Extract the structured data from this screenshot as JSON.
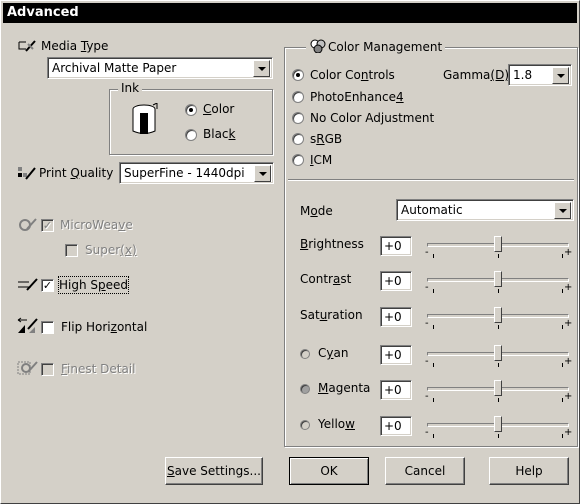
{
  "window": {
    "title": "Advanced"
  },
  "media_type": {
    "label_pre": "Media ",
    "label_u": "T",
    "label_post": "ype",
    "value": "Archival Matte Paper",
    "icon": "media-type-icon"
  },
  "ink": {
    "legend": "Ink",
    "color_pre": "",
    "color_u": "C",
    "color_post": "olor",
    "black_pre": "Blac",
    "black_u": "k",
    "black_post": "",
    "selected": "Color"
  },
  "print_quality": {
    "label_pre": "Print ",
    "label_u": "Q",
    "label_post": "uality",
    "value": "SuperFine - 1440dpi"
  },
  "options": {
    "microweave": {
      "label_pre": "MicroWea",
      "label_u": "v",
      "label_post": "e",
      "checked": true,
      "enabled": false
    },
    "super": {
      "label_pre": "Super",
      "label_u": "(x)",
      "label_post": "",
      "checked": false,
      "enabled": false
    },
    "high_speed": {
      "label_pre": "High S",
      "label_u": "p",
      "label_post": "eed",
      "checked": true,
      "enabled": true
    },
    "flip_horizontal": {
      "label_pre": "Flip Hori",
      "label_u": "z",
      "label_post": "ontal",
      "checked": false,
      "enabled": true
    },
    "finest_detail": {
      "label_pre": "",
      "label_u": "F",
      "label_post": "inest Detail",
      "checked": false,
      "enabled": false
    }
  },
  "color_management": {
    "legend": "Color Management",
    "options": [
      {
        "pre": "Color Co",
        "u": "n",
        "post": "trols",
        "selected": true
      },
      {
        "pre": "PhotoEnhance",
        "u": "4",
        "post": "",
        "selected": false
      },
      {
        "pre": "No Color Adjustment",
        "u": "",
        "post": "",
        "selected": false
      },
      {
        "pre": "s",
        "u": "R",
        "post": "GB",
        "selected": false
      },
      {
        "pre": "",
        "u": "I",
        "post": "CM",
        "selected": false
      }
    ],
    "gamma": {
      "label_pre": "Gamma",
      "label_u": "(D)",
      "value": "1.8"
    }
  },
  "mode": {
    "label_pre": "M",
    "label_u": "o",
    "label_post": "de",
    "value": "Automatic"
  },
  "sliders": [
    {
      "pre": "",
      "u": "B",
      "post": "rightness",
      "value": "+0",
      "level": 0,
      "dot": ""
    },
    {
      "pre": "Contr",
      "u": "a",
      "post": "st",
      "value": "+0",
      "level": 0,
      "dot": ""
    },
    {
      "pre": "Sat",
      "u": "u",
      "post": "ration",
      "value": "+0",
      "level": 0,
      "dot": ""
    },
    {
      "pre": "C",
      "u": "y",
      "post": "an",
      "value": "+0",
      "level": 0,
      "dot": "#d4d0c8"
    },
    {
      "pre": "",
      "u": "M",
      "post": "agenta",
      "value": "+0",
      "level": 0,
      "dot": "#a0a0a0"
    },
    {
      "pre": "Yello",
      "u": "w",
      "post": "",
      "value": "+0",
      "level": 0,
      "dot": "#d4d0c8"
    }
  ],
  "buttons": {
    "save_pre": "",
    "save_u": "S",
    "save_post": "ave Settings...",
    "ok": "OK",
    "cancel": "Cancel",
    "help": "Help"
  }
}
